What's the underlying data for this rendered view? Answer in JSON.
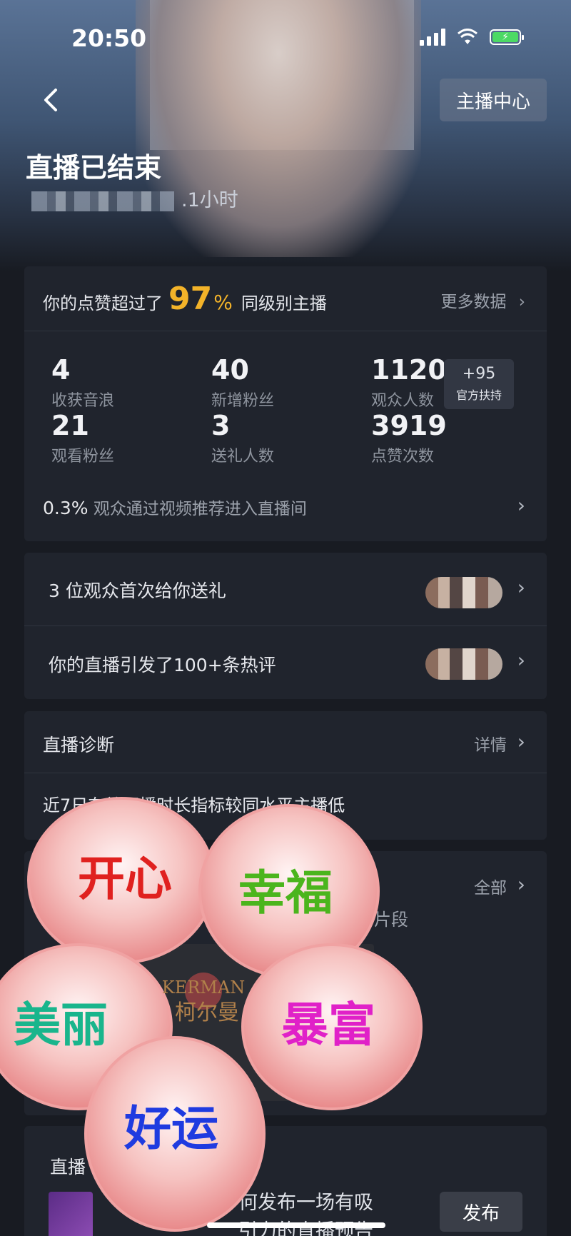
{
  "status_bar": {
    "time": "20:50"
  },
  "header": {
    "anchor_center_label": "主播中心",
    "title": "直播已结束",
    "duration": ".1小时"
  },
  "summary": {
    "like_prefix": "你的点赞超过了",
    "like_percent": "97",
    "like_percent_sign": "%",
    "like_suffix": "同级别主播",
    "more_data": "更多数据",
    "stats": [
      {
        "value": "4",
        "label": "收获音浪"
      },
      {
        "value": "40",
        "label": "新增粉丝"
      },
      {
        "value": "1120",
        "label": "观众人数"
      },
      {
        "value": "21",
        "label": "观看粉丝"
      },
      {
        "value": "3",
        "label": "送礼人数"
      },
      {
        "value": "3919",
        "label": "点赞次数"
      }
    ],
    "official_plus": "+95",
    "official_label": "官方扶持",
    "rec_percent": "0.3%",
    "rec_text": "观众通过视频推荐进入直播间"
  },
  "highlights": {
    "gift_row": "3 位观众首次给你送礼",
    "comment_row": "你的直播引发了100+条热评"
  },
  "diagnosis": {
    "title": "直播诊断",
    "detail": "详情",
    "text": "近7日有效开播时长指标较同水平主播低"
  },
  "clips": {
    "all": "全部",
    "segment": "片段"
  },
  "preview": {
    "title": "直播",
    "text_line1": "何发布一场有吸",
    "text_line2": "引力的直播预告",
    "publish": "发布"
  },
  "sticker": {
    "brand_en": "KERMAN",
    "brand_cn": "柯尔曼",
    "petals": [
      "开心",
      "幸福",
      "美丽",
      "暴富",
      "好运"
    ],
    "petal_colors": [
      "#e0211f",
      "#4bb51d",
      "#19b58c",
      "#e021c8",
      "#1f3be0"
    ]
  },
  "colors": {
    "accent": "#f3b329",
    "background": "#181b22",
    "card": "#20242d"
  }
}
